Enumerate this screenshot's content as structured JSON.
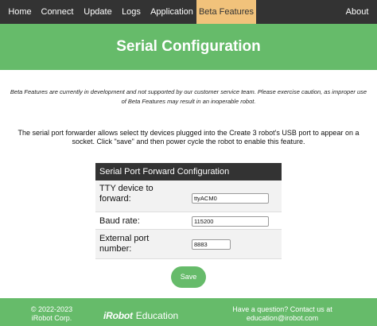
{
  "nav": {
    "items": [
      {
        "label": "Home"
      },
      {
        "label": "Connect"
      },
      {
        "label": "Update"
      },
      {
        "label": "Logs"
      },
      {
        "label": "Application"
      },
      {
        "label": "Beta Features",
        "active": true
      },
      {
        "label": "About"
      }
    ]
  },
  "header": {
    "title": "Serial Configuration"
  },
  "disclaimer": {
    "line1": "Beta Features are currently in development and not supported by our customer service team. Please exercise caution, as improper use",
    "line2": "of Beta Features may result in an inoperable robot."
  },
  "description": {
    "line1": "The serial port forwarder allows select tty devices plugged into the Create 3 robot's USB port to appear on a",
    "line2": "socket. Click \"save\" and then power cycle the robot to enable this feature."
  },
  "config": {
    "title": "Serial Port Forward Configuration",
    "tty": {
      "label_line1": "TTY device to",
      "label_line2": "forward:",
      "value": "ttyACM0"
    },
    "baud": {
      "label": "Baud rate:",
      "value": "115200"
    },
    "port": {
      "label_line1": "External port",
      "label_line2": "number:",
      "value": "8883"
    }
  },
  "save_button": {
    "label": "Save"
  },
  "footer": {
    "copyright_line1": "© 2022-2023",
    "copyright_line2": "iRobot Corp.",
    "brand_logo": "iRobot",
    "brand_sub": "Education",
    "contact_line1": "Have a question? Contact us at",
    "contact_line2": "education@irobot.com"
  },
  "colors": {
    "nav_bg": "#333333",
    "nav_active": "#f1c27b",
    "brand_green": "#66bb6a",
    "table_header": "#333333",
    "row_alt": "#f2f2f2"
  }
}
